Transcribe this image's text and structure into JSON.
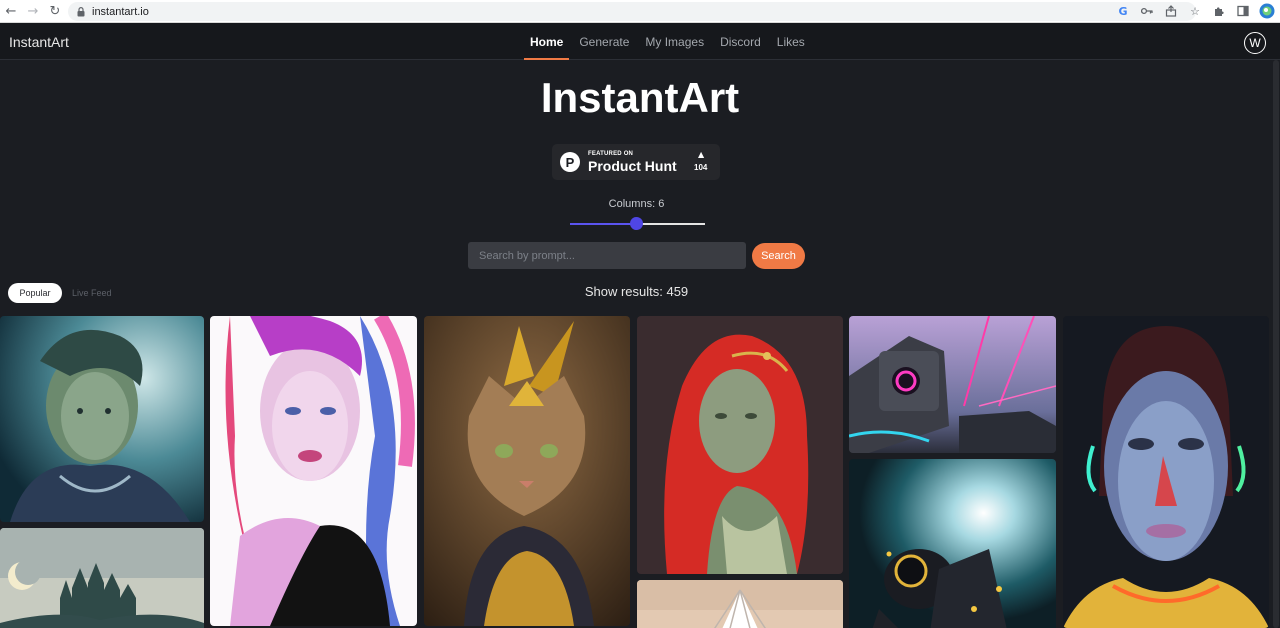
{
  "browser": {
    "url": "instantart.io",
    "profile_initial": "🌐"
  },
  "header": {
    "brand": "InstantArt",
    "nav": [
      "Home",
      "Generate",
      "My Images",
      "Discord",
      "Likes"
    ],
    "active_nav": "Home",
    "avatar_initial": "W"
  },
  "hero": {
    "title": "InstantArt"
  },
  "product_hunt": {
    "featured_on": "FEATURED ON",
    "name": "Product Hunt",
    "logo_letter": "P",
    "votes": "104"
  },
  "controls": {
    "columns_label": "Columns: 6",
    "columns_value": 6,
    "search_placeholder": "Search by prompt...",
    "search_button": "Search"
  },
  "feed": {
    "tabs": [
      "Popular",
      "Live Feed"
    ],
    "active_tab": "Popular",
    "results_text": "Show results: 459"
  },
  "colors": {
    "accent": "#f07a45",
    "slider": "#4f46e5",
    "background": "#1b1d22"
  },
  "gallery": [
    {
      "name": "tile-tattooed-woman",
      "subject": "tattooed woman with snake headdress"
    },
    {
      "name": "tile-castle",
      "subject": "fantasy castle under moon"
    },
    {
      "name": "tile-watercolor-woman",
      "subject": "watercolor woman with rainbow hair"
    },
    {
      "name": "tile-cat-warrior",
      "subject": "cat in golden armor"
    },
    {
      "name": "tile-red-hair-woman",
      "subject": "red haired woman with circlet"
    },
    {
      "name": "tile-feather",
      "subject": "white feather headdress"
    },
    {
      "name": "tile-robot-camera",
      "subject": "robot with neon lens"
    },
    {
      "name": "tile-astronaut",
      "subject": "astronaut in backlight"
    },
    {
      "name": "tile-neon-face",
      "subject": "face with neon lighting"
    }
  ]
}
